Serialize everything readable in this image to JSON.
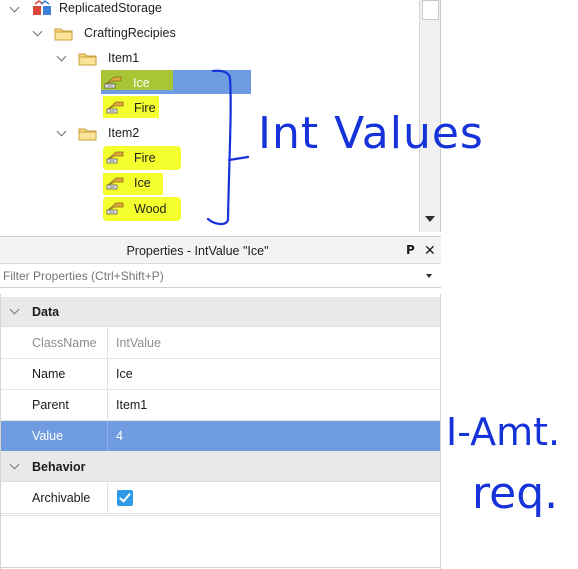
{
  "explorer": {
    "items": [
      {
        "label": "ReplicatedStorage",
        "icon": "replicated-storage-icon"
      },
      {
        "label": "CraftingRecipies",
        "icon": "folder-icon"
      },
      {
        "label": "Item1",
        "icon": "folder-icon"
      },
      {
        "label": "Ice",
        "icon": "intvalue-icon"
      },
      {
        "label": "Fire",
        "icon": "intvalue-icon"
      },
      {
        "label": "Item2",
        "icon": "folder-icon"
      },
      {
        "label": "Fire",
        "icon": "intvalue-icon"
      },
      {
        "label": "Ice",
        "icon": "intvalue-icon"
      },
      {
        "label": "Wood",
        "icon": "intvalue-icon"
      }
    ]
  },
  "properties": {
    "title": "Properties - IntValue \"Ice\"",
    "filter_placeholder": "Filter Properties (Ctrl+Shift+P)",
    "groups": [
      {
        "label": "Data"
      },
      {
        "label": "Behavior"
      }
    ],
    "rows": [
      {
        "name": "ClassName",
        "value": "IntValue"
      },
      {
        "name": "Name",
        "value": "Ice"
      },
      {
        "name": "Parent",
        "value": "Item1"
      },
      {
        "name": "Value",
        "value": "4"
      },
      {
        "name": "Archivable",
        "value": true
      }
    ]
  },
  "annotations": {
    "int_values": "Int Values",
    "amt_line1": "I-Amt.",
    "amt_line2": "req."
  },
  "colors": {
    "selection": "#6f9be0",
    "highlight": "#f4ff2e",
    "annotation_ink": "#1633d9",
    "checkbox": "#2e9be8"
  }
}
